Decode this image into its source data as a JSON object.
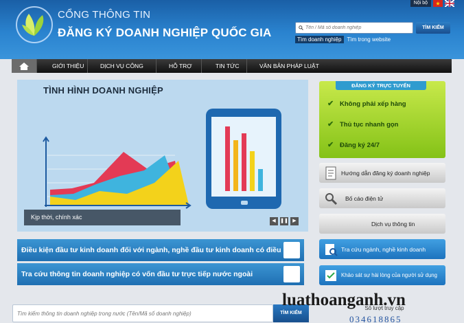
{
  "header": {
    "site_title_small": "CỔNG THÔNG TIN",
    "site_title_big": "ĐĂNG KÝ DOANH NGHIỆP QUỐC GIA",
    "login_label": "Nội bộ",
    "search_placeholder": "Tên / Mã số doanh nghiệp",
    "search_button": "TÌM KIẾM",
    "search_tabs": [
      "Tìm doanh nghiệp",
      "Tìm trong website"
    ],
    "active_tab": 0,
    "colors": {
      "header_blue": "#2a83cf",
      "nav_dark": "#1b1b1b"
    }
  },
  "nav": {
    "home_icon": "home-icon",
    "items": [
      "GIỚI THIỆU",
      "DỊCH VỤ CÔNG",
      "HỖ TRỢ",
      "TIN TỨC",
      "VĂN BẢN PHÁP LUẬT"
    ]
  },
  "hero": {
    "title": "TÌNH HÌNH DOANH NGHIỆP",
    "caption": "Kịp thời, chính xác",
    "controls": [
      "prev-icon",
      "pause-icon",
      "next-icon"
    ]
  },
  "banners": [
    "Điều kiện đầu tư kinh doanh đối với ngành, nghề đầu tư kinh doanh có điều kiện",
    "Tra cứu thông tin doanh nghiệp có vốn đầu tư trực tiếp nước ngoài"
  ],
  "online_registration": {
    "ribbon": "ĐĂNG KÝ TRỰC TUYẾN",
    "items": [
      "Không phải xếp hàng",
      "Thủ tục nhanh gọn",
      "Đăng ký 24/7"
    ]
  },
  "side_buttons": [
    {
      "label": "Hướng dẫn đăng ký doanh nghiệp",
      "icon": "document-icon",
      "style": "gray"
    },
    {
      "label": "Bố cáo điện tử",
      "icon": "magnifier-icon",
      "style": "gray"
    },
    {
      "label": "Dịch vụ thông tin",
      "icon": "",
      "style": "gray"
    },
    {
      "label": "Tra cứu ngành, nghề kinh doanh",
      "icon": "search-document-icon",
      "style": "blue"
    },
    {
      "label": "Khảo sát sự hài lòng của người sử dụng",
      "icon": "survey-icon",
      "style": "blue"
    }
  ],
  "bottom": {
    "search_placeholder": "Tìm kiếm thông tin doanh nghiệp trong nước (Tên/Mã số doanh nghiệp)",
    "search_button": "TÌM KIẾM",
    "visits_label": "Số lượt truy cập",
    "visits_count": "034618865"
  },
  "watermark": "luathoanganh.vn"
}
